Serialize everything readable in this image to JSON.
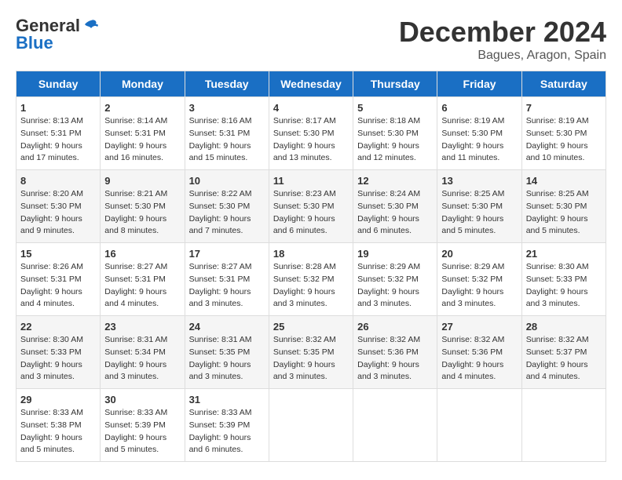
{
  "header": {
    "logo_line1": "General",
    "logo_line2": "Blue",
    "month": "December 2024",
    "location": "Bagues, Aragon, Spain"
  },
  "weekdays": [
    "Sunday",
    "Monday",
    "Tuesday",
    "Wednesday",
    "Thursday",
    "Friday",
    "Saturday"
  ],
  "weeks": [
    [
      {
        "day": 1,
        "rise": "8:13 AM",
        "set": "5:31 PM",
        "daylight": "9 hours and 17 minutes."
      },
      {
        "day": 2,
        "rise": "8:14 AM",
        "set": "5:31 PM",
        "daylight": "9 hours and 16 minutes."
      },
      {
        "day": 3,
        "rise": "8:16 AM",
        "set": "5:31 PM",
        "daylight": "9 hours and 15 minutes."
      },
      {
        "day": 4,
        "rise": "8:17 AM",
        "set": "5:30 PM",
        "daylight": "9 hours and 13 minutes."
      },
      {
        "day": 5,
        "rise": "8:18 AM",
        "set": "5:30 PM",
        "daylight": "9 hours and 12 minutes."
      },
      {
        "day": 6,
        "rise": "8:19 AM",
        "set": "5:30 PM",
        "daylight": "9 hours and 11 minutes."
      },
      {
        "day": 7,
        "rise": "8:19 AM",
        "set": "5:30 PM",
        "daylight": "9 hours and 10 minutes."
      }
    ],
    [
      {
        "day": 8,
        "rise": "8:20 AM",
        "set": "5:30 PM",
        "daylight": "9 hours and 9 minutes."
      },
      {
        "day": 9,
        "rise": "8:21 AM",
        "set": "5:30 PM",
        "daylight": "9 hours and 8 minutes."
      },
      {
        "day": 10,
        "rise": "8:22 AM",
        "set": "5:30 PM",
        "daylight": "9 hours and 7 minutes."
      },
      {
        "day": 11,
        "rise": "8:23 AM",
        "set": "5:30 PM",
        "daylight": "9 hours and 6 minutes."
      },
      {
        "day": 12,
        "rise": "8:24 AM",
        "set": "5:30 PM",
        "daylight": "9 hours and 6 minutes."
      },
      {
        "day": 13,
        "rise": "8:25 AM",
        "set": "5:30 PM",
        "daylight": "9 hours and 5 minutes."
      },
      {
        "day": 14,
        "rise": "8:25 AM",
        "set": "5:30 PM",
        "daylight": "9 hours and 5 minutes."
      }
    ],
    [
      {
        "day": 15,
        "rise": "8:26 AM",
        "set": "5:31 PM",
        "daylight": "9 hours and 4 minutes."
      },
      {
        "day": 16,
        "rise": "8:27 AM",
        "set": "5:31 PM",
        "daylight": "9 hours and 4 minutes."
      },
      {
        "day": 17,
        "rise": "8:27 AM",
        "set": "5:31 PM",
        "daylight": "9 hours and 3 minutes."
      },
      {
        "day": 18,
        "rise": "8:28 AM",
        "set": "5:32 PM",
        "daylight": "9 hours and 3 minutes."
      },
      {
        "day": 19,
        "rise": "8:29 AM",
        "set": "5:32 PM",
        "daylight": "9 hours and 3 minutes."
      },
      {
        "day": 20,
        "rise": "8:29 AM",
        "set": "5:32 PM",
        "daylight": "9 hours and 3 minutes."
      },
      {
        "day": 21,
        "rise": "8:30 AM",
        "set": "5:33 PM",
        "daylight": "9 hours and 3 minutes."
      }
    ],
    [
      {
        "day": 22,
        "rise": "8:30 AM",
        "set": "5:33 PM",
        "daylight": "9 hours and 3 minutes."
      },
      {
        "day": 23,
        "rise": "8:31 AM",
        "set": "5:34 PM",
        "daylight": "9 hours and 3 minutes."
      },
      {
        "day": 24,
        "rise": "8:31 AM",
        "set": "5:35 PM",
        "daylight": "9 hours and 3 minutes."
      },
      {
        "day": 25,
        "rise": "8:32 AM",
        "set": "5:35 PM",
        "daylight": "9 hours and 3 minutes."
      },
      {
        "day": 26,
        "rise": "8:32 AM",
        "set": "5:36 PM",
        "daylight": "9 hours and 3 minutes."
      },
      {
        "day": 27,
        "rise": "8:32 AM",
        "set": "5:36 PM",
        "daylight": "9 hours and 4 minutes."
      },
      {
        "day": 28,
        "rise": "8:32 AM",
        "set": "5:37 PM",
        "daylight": "9 hours and 4 minutes."
      }
    ],
    [
      {
        "day": 29,
        "rise": "8:33 AM",
        "set": "5:38 PM",
        "daylight": "9 hours and 5 minutes."
      },
      {
        "day": 30,
        "rise": "8:33 AM",
        "set": "5:39 PM",
        "daylight": "9 hours and 5 minutes."
      },
      {
        "day": 31,
        "rise": "8:33 AM",
        "set": "5:39 PM",
        "daylight": "9 hours and 6 minutes."
      },
      null,
      null,
      null,
      null
    ]
  ]
}
